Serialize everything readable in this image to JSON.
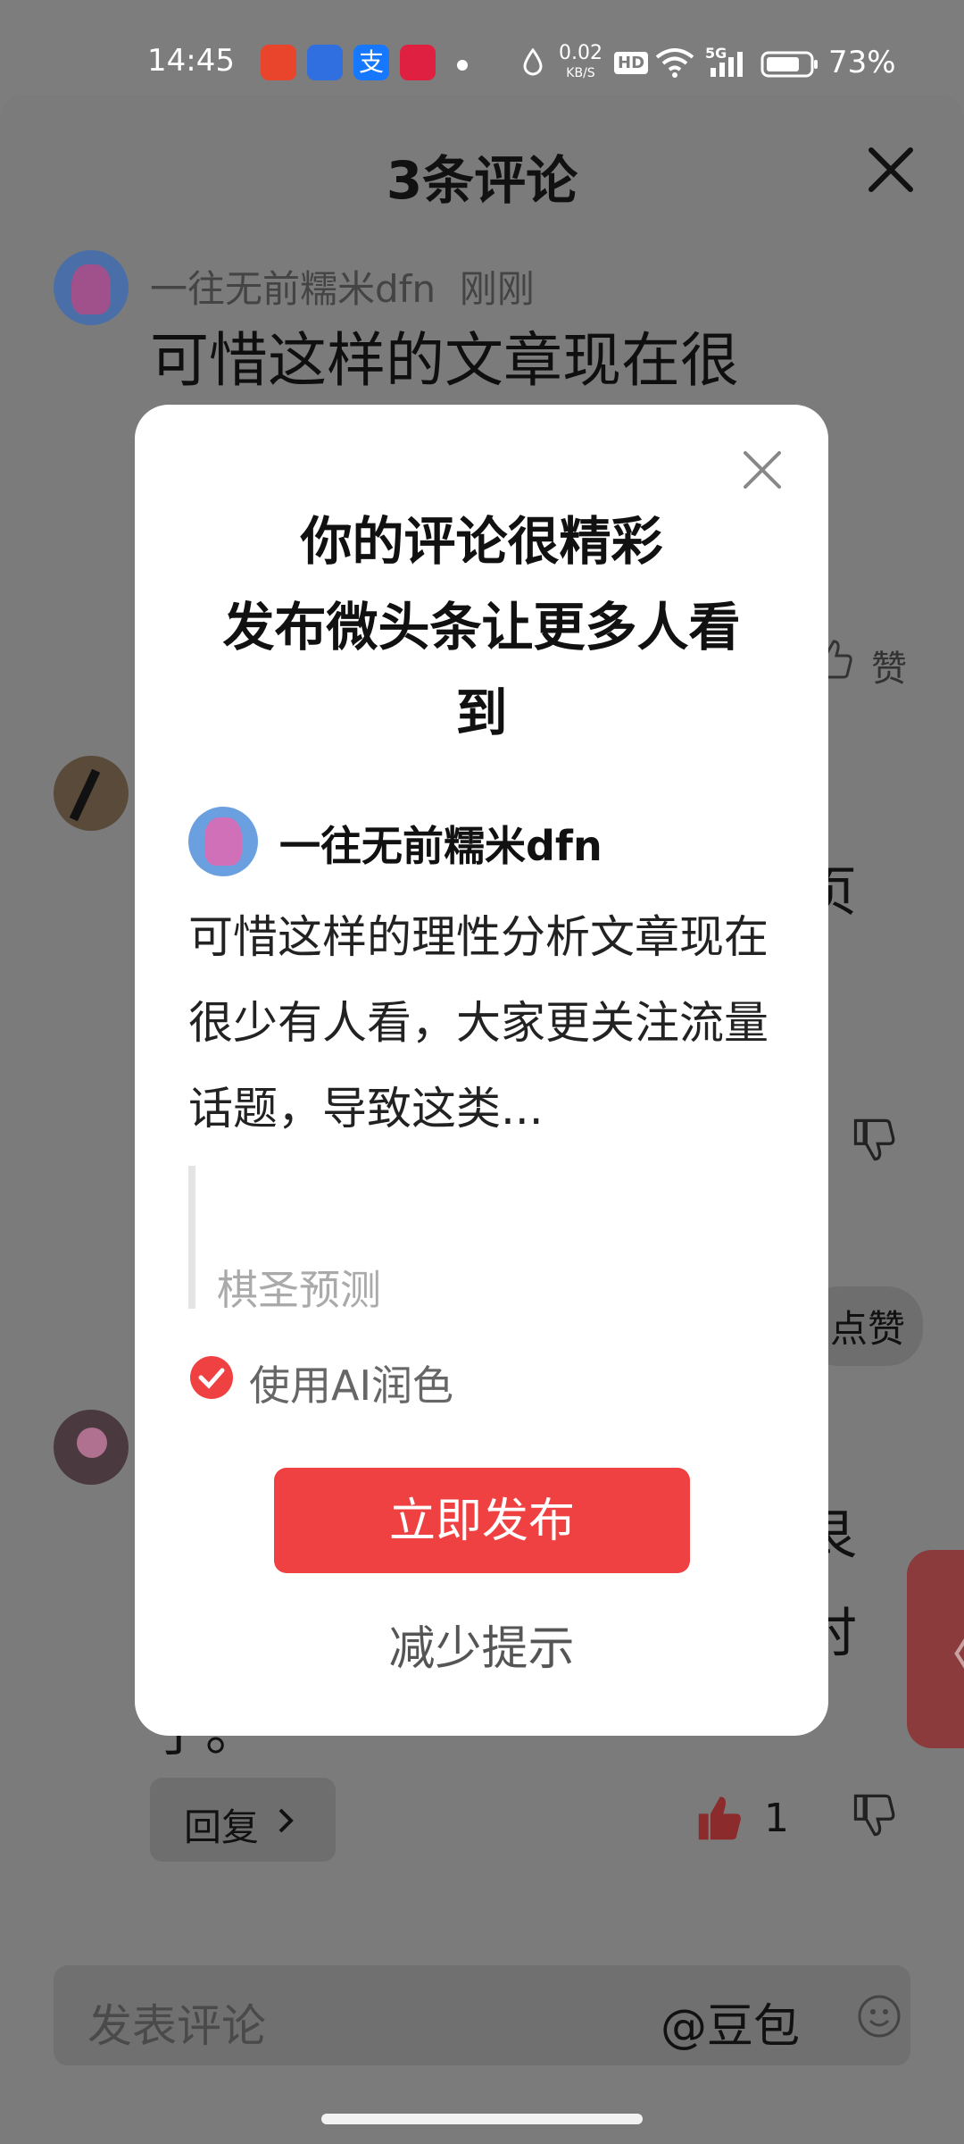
{
  "status_bar": {
    "time": "14:45",
    "net_speed": "0.02",
    "net_unit": "KB/S",
    "hd": "HD",
    "signal": "5G",
    "battery": "73%",
    "colors": {
      "app1": "#e8452c",
      "app2": "#2f6fe0",
      "app3": "#1677ff",
      "app4": "#e02040"
    }
  },
  "sheet": {
    "title": "3条评论",
    "comments": [
      {
        "user": "一往无前糯米dfn",
        "time": "刚刚",
        "text": "可惜这样的文章现在很"
      },
      {
        "text_partial": "页"
      },
      {
        "text_partial": "艮",
        "text_partial_2": "时",
        "text_partial_3": "了。",
        "likes": "1",
        "reply": "回复"
      }
    ],
    "like_label": "赞",
    "like_chip": "点赞",
    "input_placeholder": "发表评论",
    "mention": "@豆包",
    "side_tab_icon": "〈"
  },
  "modal": {
    "title_line1": "你的评论很精彩",
    "title_line2": "发布微头条让更多人看",
    "title_line3": "到",
    "username": "一往无前糯米dfn",
    "preview": "可惜这样的理性分析文章现在很少有人看，大家更关注流量话题，导致这类...",
    "quote": "棋圣预测",
    "ai_polish": "使用AI润色",
    "ai_polish_checked": true,
    "publish": "立即发布",
    "reduce": "减少提示",
    "accent": "#f04142"
  }
}
